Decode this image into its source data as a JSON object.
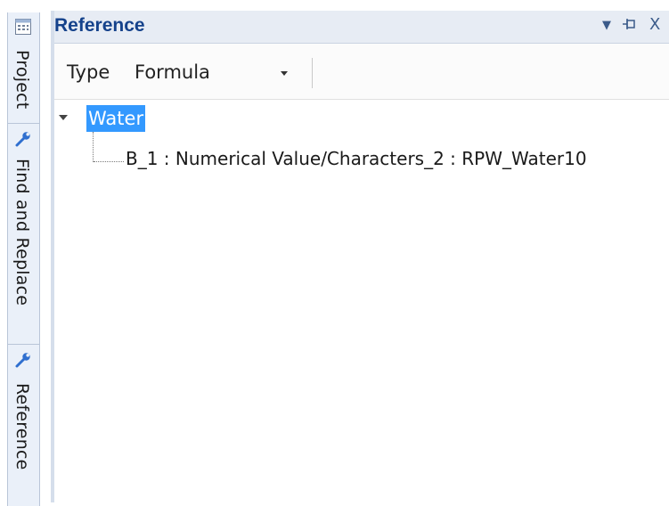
{
  "side_tabs": [
    {
      "label": "Project",
      "icon": "grid-window-icon"
    },
    {
      "label": "Find and Replace",
      "icon": "wrench-icon"
    },
    {
      "label": "Reference",
      "icon": "wrench-icon"
    }
  ],
  "panel": {
    "title": "Reference",
    "controls": {
      "menu": "▼",
      "pin": "⊣",
      "close": "X"
    }
  },
  "toolbar": {
    "type_label": "Type",
    "type_value": "Formula"
  },
  "tree": {
    "root_label": "Water",
    "children": [
      {
        "label": "B_1 : Numerical Value/Characters_2 : RPW_Water10"
      }
    ]
  },
  "colors": {
    "title_text": "#15428b",
    "selection": "#3399ff",
    "side_bg": "#eaf0f9",
    "title_bg": "#e7ecf4"
  }
}
